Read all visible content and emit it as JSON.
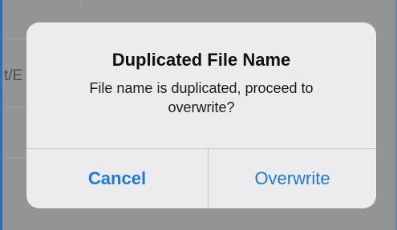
{
  "background": {
    "partial_text": "t/E"
  },
  "alert": {
    "title": "Duplicated File Name",
    "message": "File name is duplicated, proceed to overwrite?",
    "buttons": {
      "cancel": "Cancel",
      "overwrite": "Overwrite"
    }
  },
  "colors": {
    "accent": "#1a7ae0",
    "dialog_bg": "#ececee",
    "overlay": "#939496"
  }
}
